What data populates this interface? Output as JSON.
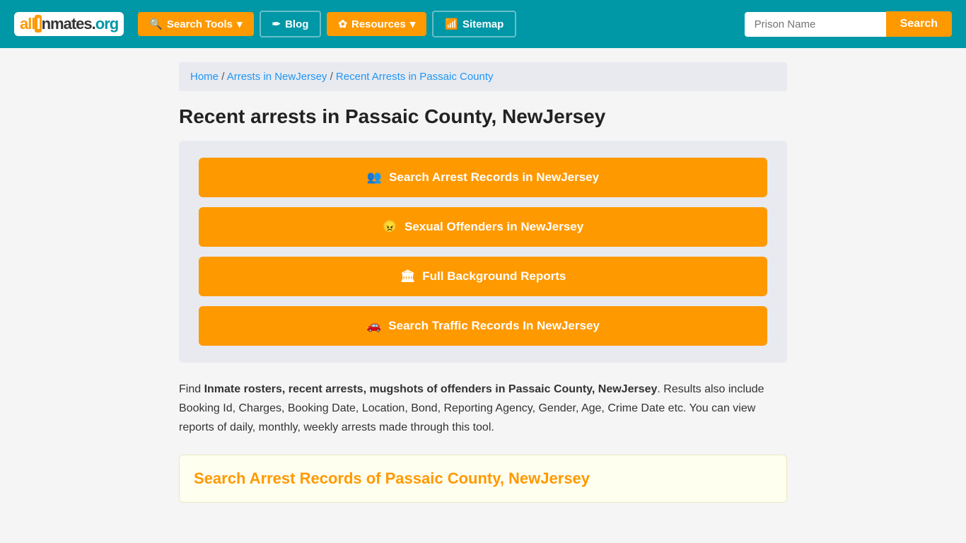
{
  "header": {
    "logo_text": "all",
    "logo_middle": "I",
    "logo_end": "nmates",
    "logo_org": ".org",
    "nav": [
      {
        "id": "search-tools",
        "label": "Search Tools",
        "icon": "🔍",
        "dropdown": true,
        "style": "orange"
      },
      {
        "id": "blog",
        "label": "Blog",
        "icon": "✒",
        "dropdown": false,
        "style": "plain"
      },
      {
        "id": "resources",
        "label": "Resources",
        "icon": "✿",
        "dropdown": true,
        "style": "orange"
      },
      {
        "id": "sitemap",
        "label": "Sitemap",
        "icon": "📶",
        "dropdown": false,
        "style": "plain"
      }
    ],
    "search_placeholder": "Prison Name",
    "search_button_label": "Search"
  },
  "breadcrumb": {
    "items": [
      {
        "label": "Home",
        "link": true
      },
      {
        "separator": " / "
      },
      {
        "label": "Arrests in NewJersey",
        "link": true
      },
      {
        "separator": " / "
      },
      {
        "label": "Recent Arrests in Passaic County",
        "link": true
      }
    ]
  },
  "page": {
    "title": "Recent arrests in Passaic County, NewJersey",
    "action_buttons": [
      {
        "id": "arrest-records",
        "icon": "👥",
        "label": "Search Arrest Records in NewJersey"
      },
      {
        "id": "sexual-offenders",
        "icon": "😠",
        "label": "Sexual Offenders in NewJersey"
      },
      {
        "id": "background-reports",
        "icon": "🏛",
        "label": "Full Background Reports"
      },
      {
        "id": "traffic-records",
        "icon": "🚗",
        "label": "Search Traffic Records In NewJersey"
      }
    ],
    "description_prefix": "Find ",
    "description_bold": "Inmate rosters, recent arrests, mugshots of offenders in Passaic County, NewJersey",
    "description_suffix": ". Results also include Booking Id, Charges, Booking Date, Location, Bond, Reporting Agency, Gender, Age, Crime Date etc. You can view reports of daily, monthly, weekly arrests made through this tool.",
    "bottom_search_title": "Search Arrest Records of Passaic County, NewJersey"
  }
}
